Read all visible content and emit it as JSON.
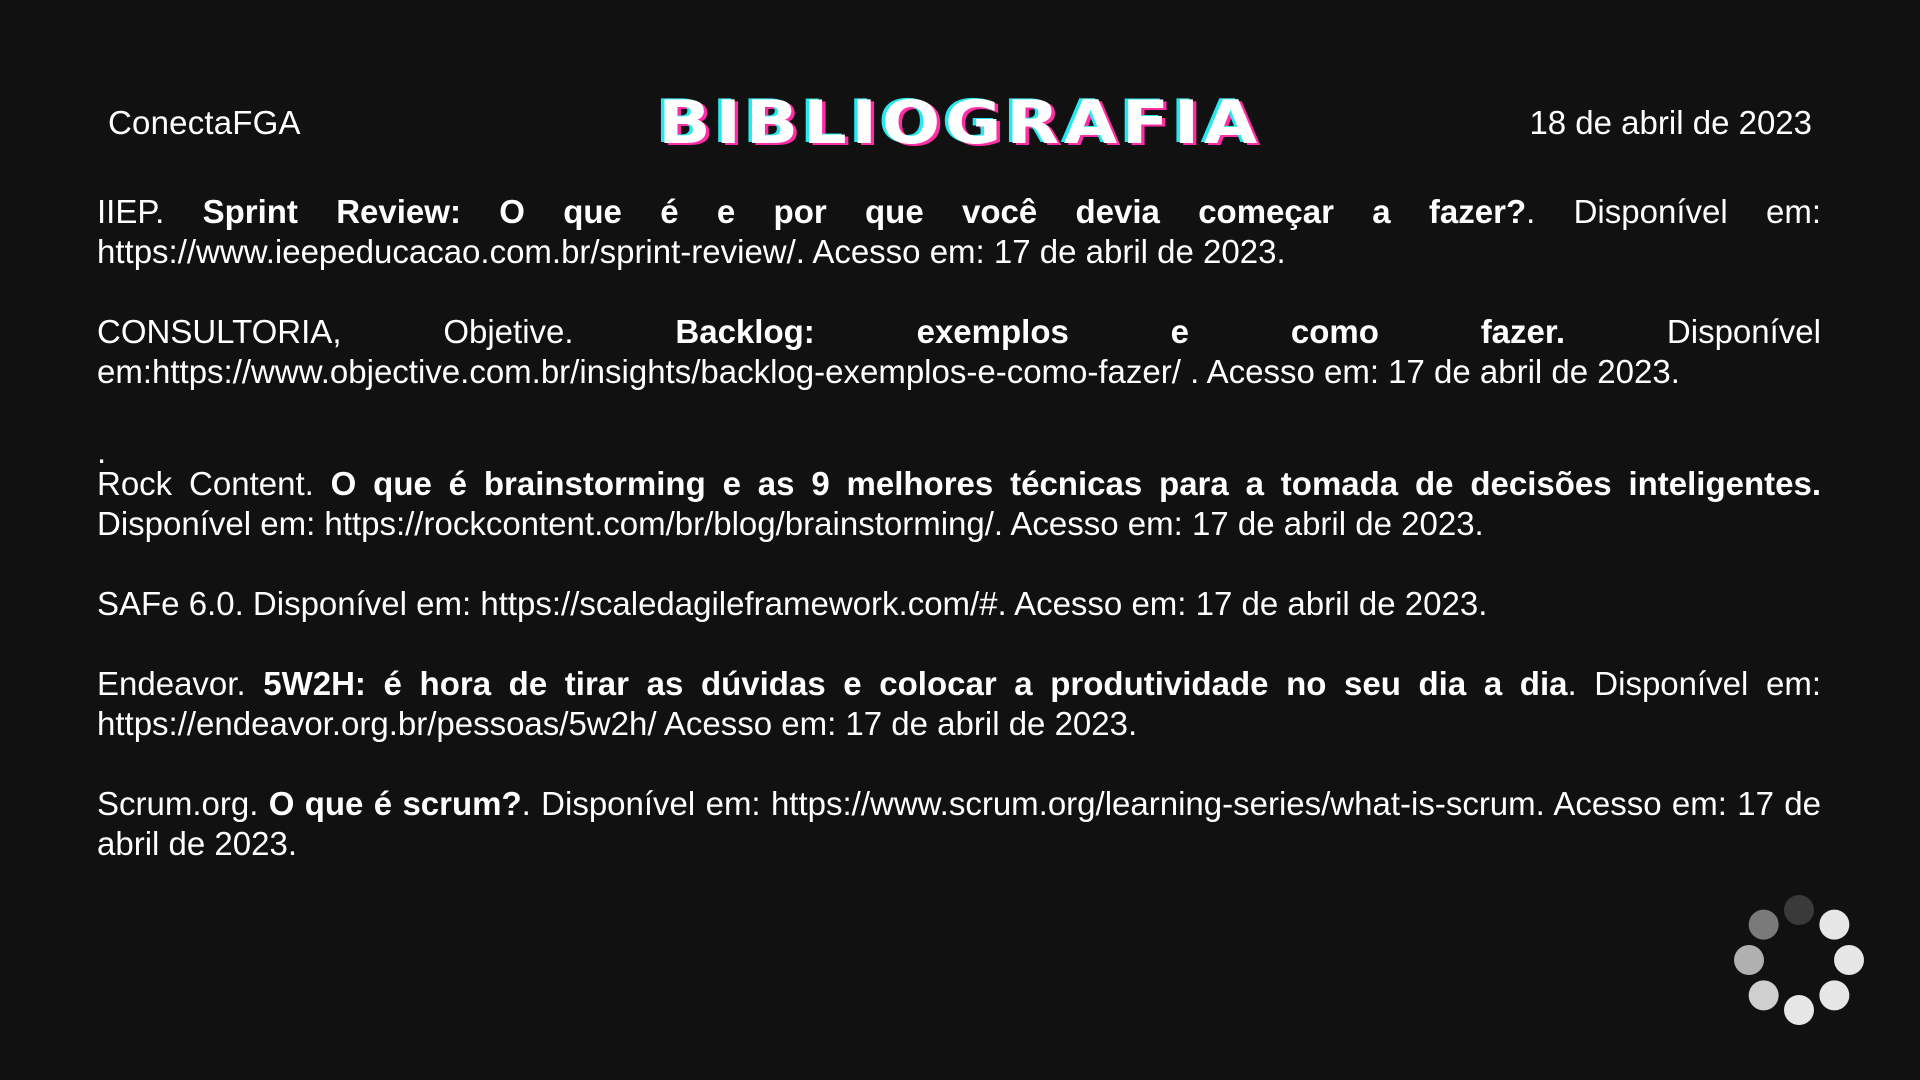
{
  "header": {
    "brand": "ConectaFGA",
    "title": "BIBLIOGRAFIA",
    "date": "18 de abril de 2023"
  },
  "references": [
    {
      "prefix": "IIEP. ",
      "bold": "Sprint Review: O que é e por que você devia começar a fazer?",
      "suffix": ". Disponível em: https://www.ieepeducacao.com.br/sprint-review/. Acesso em: 17 de abril de 2023."
    },
    {
      "prefix": "CONSULTORIA, Objetive. ",
      "bold": "Backlog: exemplos e como fazer.",
      "suffix": " Disponível em:https://www.objective.com.br/insights/backlog-exemplos-e-como-fazer/ . Acesso em: 17 de abril de 2023."
    },
    {
      "lead": ".",
      "prefix": "Rock Content. ",
      "bold": "O que é brainstorming e as 9 melhores técnicas para a tomada de decisões inteligentes.",
      "suffix": " Disponível em: https://rockcontent.com/br/blog/brainstorming/. Acesso em: 17 de abril de 2023."
    },
    {
      "text": "SAFe 6.0. Disponível em: https://scaledagileframework.com/#. Acesso em: 17 de abril de 2023."
    },
    {
      "prefix": "Endeavor. ",
      "bold": "5W2H: é hora de tirar as dúvidas e colocar a produtividade no seu dia a dia",
      "suffix": ". Disponível em: https://endeavor.org.br/pessoas/5w2h/ Acesso em: 17 de abril de 2023."
    },
    {
      "prefix": "Scrum.org. ",
      "bold": "O que é scrum?",
      "suffix": ". Disponível em: https://www.scrum.org/learning-series/what-is-scrum. Acesso em: 17 de abril de 2023."
    }
  ],
  "spinner": {
    "icon": "loading-spinner-icon",
    "colors": [
      "#3a3a3a",
      "#e6e6e6",
      "#e6e6e6",
      "#e6e6e6",
      "#e6e6e6",
      "#cfcfcf",
      "#b0b0b0",
      "#7a7a7a"
    ]
  },
  "colors": {
    "background": "#111111",
    "text": "#ffffff",
    "title_cyan": "#27e7f0",
    "title_magenta": "#ff2ea6"
  }
}
